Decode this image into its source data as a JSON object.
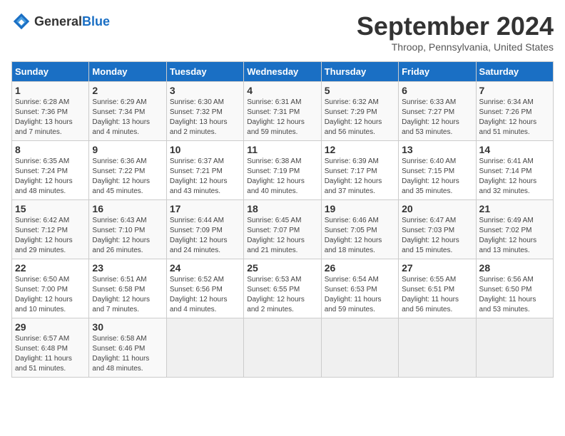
{
  "header": {
    "logo_general": "General",
    "logo_blue": "Blue",
    "month_title": "September 2024",
    "location": "Throop, Pennsylvania, United States"
  },
  "days_of_week": [
    "Sunday",
    "Monday",
    "Tuesday",
    "Wednesday",
    "Thursday",
    "Friday",
    "Saturday"
  ],
  "weeks": [
    [
      {
        "day": "1",
        "info": "Sunrise: 6:28 AM\nSunset: 7:36 PM\nDaylight: 13 hours\nand 7 minutes."
      },
      {
        "day": "2",
        "info": "Sunrise: 6:29 AM\nSunset: 7:34 PM\nDaylight: 13 hours\nand 4 minutes."
      },
      {
        "day": "3",
        "info": "Sunrise: 6:30 AM\nSunset: 7:32 PM\nDaylight: 13 hours\nand 2 minutes."
      },
      {
        "day": "4",
        "info": "Sunrise: 6:31 AM\nSunset: 7:31 PM\nDaylight: 12 hours\nand 59 minutes."
      },
      {
        "day": "5",
        "info": "Sunrise: 6:32 AM\nSunset: 7:29 PM\nDaylight: 12 hours\nand 56 minutes."
      },
      {
        "day": "6",
        "info": "Sunrise: 6:33 AM\nSunset: 7:27 PM\nDaylight: 12 hours\nand 53 minutes."
      },
      {
        "day": "7",
        "info": "Sunrise: 6:34 AM\nSunset: 7:26 PM\nDaylight: 12 hours\nand 51 minutes."
      }
    ],
    [
      {
        "day": "8",
        "info": "Sunrise: 6:35 AM\nSunset: 7:24 PM\nDaylight: 12 hours\nand 48 minutes."
      },
      {
        "day": "9",
        "info": "Sunrise: 6:36 AM\nSunset: 7:22 PM\nDaylight: 12 hours\nand 45 minutes."
      },
      {
        "day": "10",
        "info": "Sunrise: 6:37 AM\nSunset: 7:21 PM\nDaylight: 12 hours\nand 43 minutes."
      },
      {
        "day": "11",
        "info": "Sunrise: 6:38 AM\nSunset: 7:19 PM\nDaylight: 12 hours\nand 40 minutes."
      },
      {
        "day": "12",
        "info": "Sunrise: 6:39 AM\nSunset: 7:17 PM\nDaylight: 12 hours\nand 37 minutes."
      },
      {
        "day": "13",
        "info": "Sunrise: 6:40 AM\nSunset: 7:15 PM\nDaylight: 12 hours\nand 35 minutes."
      },
      {
        "day": "14",
        "info": "Sunrise: 6:41 AM\nSunset: 7:14 PM\nDaylight: 12 hours\nand 32 minutes."
      }
    ],
    [
      {
        "day": "15",
        "info": "Sunrise: 6:42 AM\nSunset: 7:12 PM\nDaylight: 12 hours\nand 29 minutes."
      },
      {
        "day": "16",
        "info": "Sunrise: 6:43 AM\nSunset: 7:10 PM\nDaylight: 12 hours\nand 26 minutes."
      },
      {
        "day": "17",
        "info": "Sunrise: 6:44 AM\nSunset: 7:09 PM\nDaylight: 12 hours\nand 24 minutes."
      },
      {
        "day": "18",
        "info": "Sunrise: 6:45 AM\nSunset: 7:07 PM\nDaylight: 12 hours\nand 21 minutes."
      },
      {
        "day": "19",
        "info": "Sunrise: 6:46 AM\nSunset: 7:05 PM\nDaylight: 12 hours\nand 18 minutes."
      },
      {
        "day": "20",
        "info": "Sunrise: 6:47 AM\nSunset: 7:03 PM\nDaylight: 12 hours\nand 15 minutes."
      },
      {
        "day": "21",
        "info": "Sunrise: 6:49 AM\nSunset: 7:02 PM\nDaylight: 12 hours\nand 13 minutes."
      }
    ],
    [
      {
        "day": "22",
        "info": "Sunrise: 6:50 AM\nSunset: 7:00 PM\nDaylight: 12 hours\nand 10 minutes."
      },
      {
        "day": "23",
        "info": "Sunrise: 6:51 AM\nSunset: 6:58 PM\nDaylight: 12 hours\nand 7 minutes."
      },
      {
        "day": "24",
        "info": "Sunrise: 6:52 AM\nSunset: 6:56 PM\nDaylight: 12 hours\nand 4 minutes."
      },
      {
        "day": "25",
        "info": "Sunrise: 6:53 AM\nSunset: 6:55 PM\nDaylight: 12 hours\nand 2 minutes."
      },
      {
        "day": "26",
        "info": "Sunrise: 6:54 AM\nSunset: 6:53 PM\nDaylight: 11 hours\nand 59 minutes."
      },
      {
        "day": "27",
        "info": "Sunrise: 6:55 AM\nSunset: 6:51 PM\nDaylight: 11 hours\nand 56 minutes."
      },
      {
        "day": "28",
        "info": "Sunrise: 6:56 AM\nSunset: 6:50 PM\nDaylight: 11 hours\nand 53 minutes."
      }
    ],
    [
      {
        "day": "29",
        "info": "Sunrise: 6:57 AM\nSunset: 6:48 PM\nDaylight: 11 hours\nand 51 minutes."
      },
      {
        "day": "30",
        "info": "Sunrise: 6:58 AM\nSunset: 6:46 PM\nDaylight: 11 hours\nand 48 minutes."
      },
      {
        "day": "",
        "info": ""
      },
      {
        "day": "",
        "info": ""
      },
      {
        "day": "",
        "info": ""
      },
      {
        "day": "",
        "info": ""
      },
      {
        "day": "",
        "info": ""
      }
    ]
  ]
}
